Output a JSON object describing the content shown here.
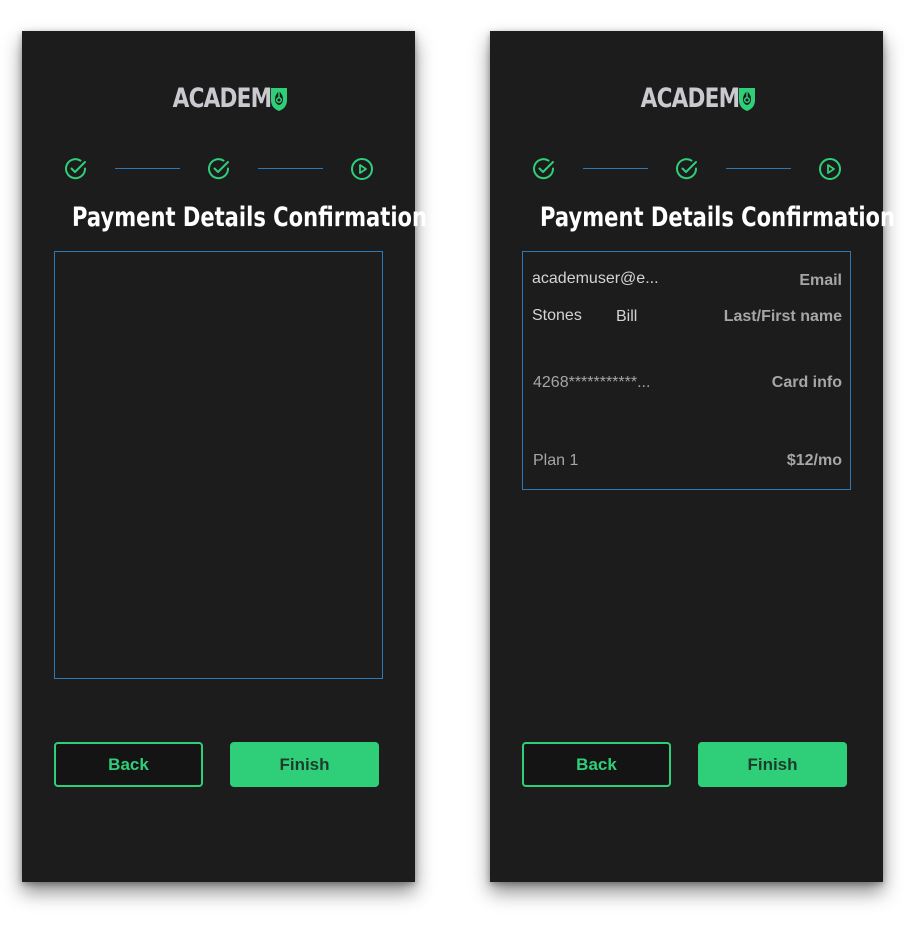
{
  "brand": {
    "name": "ACADEM",
    "logo_mark": "pen-nib-shield-icon",
    "color": "#2fcf79"
  },
  "stepper": {
    "steps": [
      {
        "state": "complete",
        "icon": "check-circle-icon"
      },
      {
        "state": "complete",
        "icon": "check-circle-icon"
      },
      {
        "state": "current",
        "icon": "play-circle-icon"
      }
    ]
  },
  "title": "Payment Details Confirmation",
  "details": {
    "email_value": "academuser@e...",
    "email_label": "Email",
    "last_name": "Stones",
    "first_name": "Bill",
    "name_label": "Last/First name",
    "card_value": "4268***********...",
    "card_label": "Card info",
    "plan_value": "Plan 1",
    "price_label": "$12/mo"
  },
  "buttons": {
    "back": "Back",
    "finish": "Finish"
  },
  "colors": {
    "accent": "#2fcf79",
    "border": "#2e78b5",
    "background": "#1c1c1c"
  }
}
